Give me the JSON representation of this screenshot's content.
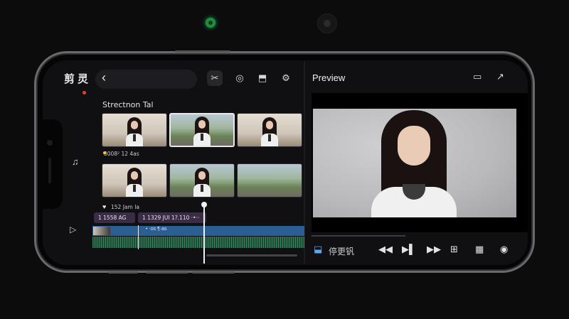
{
  "app": {
    "title": "剪灵"
  },
  "toolbar": {
    "back_icon": "chevron-left-icon",
    "tools": [
      {
        "name": "split-clip",
        "glyph": "✂"
      },
      {
        "name": "speed",
        "glyph": "◎"
      },
      {
        "name": "export",
        "glyph": "⬒"
      },
      {
        "name": "settings",
        "glyph": "⚙"
      }
    ]
  },
  "media": {
    "section_title": "Strectnon Tal",
    "subsection": "3008² 12 4as",
    "likes": "152 Jam Ia",
    "thumbnails": [
      {
        "scene": "indoor"
      },
      {
        "scene": "outdoor",
        "selected": true
      },
      {
        "scene": "indoor"
      },
      {
        "scene": "indoor"
      },
      {
        "scene": "outdoor"
      },
      {
        "scene": "outdoor-empty"
      }
    ]
  },
  "timeline": {
    "clips": [
      {
        "label": "1 1558 AG"
      },
      {
        "label": "1 1329 JUI   1?.110 ·•··"
      }
    ],
    "video_track_text": "• ·os ¶·as"
  },
  "preview": {
    "title": "Preview",
    "icons": [
      "screen-icon",
      "share-icon"
    ]
  },
  "bottom_toolbar": {
    "crop_label": "停更钒",
    "buttons": [
      "prev-frame-icon",
      "play-icon",
      "next-frame-icon",
      "add-icon",
      "grid-icon",
      "camera-icon"
    ]
  },
  "colors": {
    "accent": "#5aa9f0",
    "video_track": "#2b5f94",
    "audio_track": "#1e4a36",
    "clip_label": "#3a2c44",
    "record_dot": "#e0403a"
  }
}
